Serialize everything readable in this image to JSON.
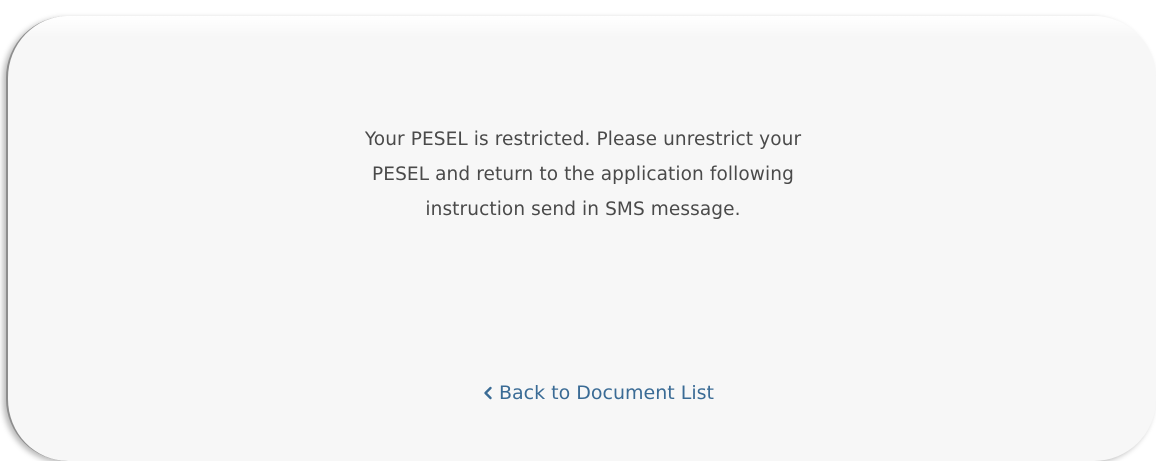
{
  "message": {
    "line1": "Your PESEL is restricted. Please unrestrict your",
    "line2": "PESEL and return to the application following",
    "line3": "instruction send in SMS message."
  },
  "back_link": {
    "label": "Back to Document List",
    "icon": "chevron-left-icon"
  },
  "colors": {
    "text": "#4a4a4a",
    "link": "#3a6b95",
    "card_background": "#f7f7f7"
  }
}
